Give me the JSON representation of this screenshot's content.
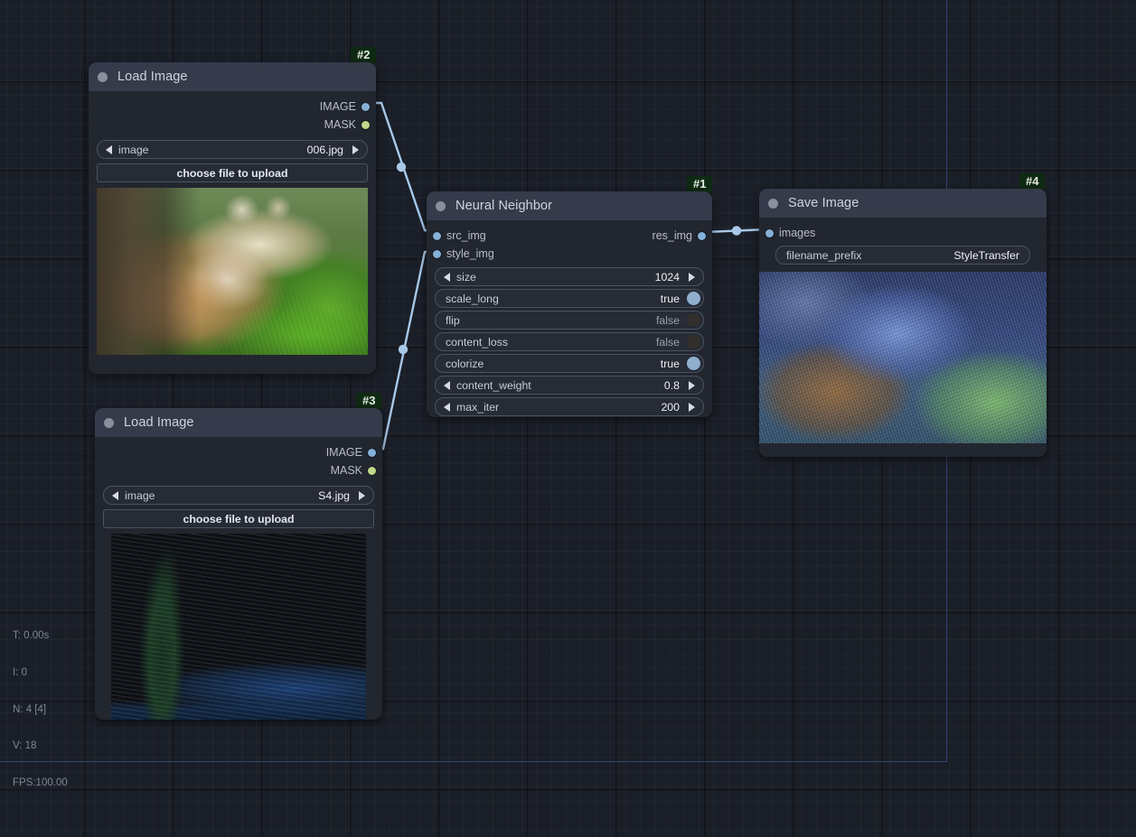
{
  "app": {
    "kind": "node-graph-editor",
    "background_color": "#1a1e27",
    "node_body_color": "#22262f",
    "node_header_color": "#353b4a",
    "link_color": "#a8c8e8",
    "badge_color": "#0f2a12"
  },
  "nodes": [
    {
      "id": "neural-neighbor",
      "badge": "#1",
      "title": "Neural Neighbor",
      "inputs": [
        {
          "name": "src_img",
          "type": "IMAGE"
        },
        {
          "name": "style_img",
          "type": "IMAGE"
        }
      ],
      "outputs": [
        {
          "name": "res_img",
          "type": "IMAGE"
        }
      ],
      "widgets": [
        {
          "name": "size",
          "value": "1024",
          "kind": "number"
        },
        {
          "name": "scale_long",
          "value": "true",
          "kind": "toggle",
          "on": true
        },
        {
          "name": "flip",
          "value": "false",
          "kind": "toggle",
          "on": false
        },
        {
          "name": "content_loss",
          "value": "false",
          "kind": "toggle",
          "on": false
        },
        {
          "name": "colorize",
          "value": "true",
          "kind": "toggle",
          "on": true
        },
        {
          "name": "content_weight",
          "value": "0.8",
          "kind": "number"
        },
        {
          "name": "max_iter",
          "value": "200",
          "kind": "number"
        }
      ]
    },
    {
      "id": "load-image-src",
      "badge": "#2",
      "title": "Load Image",
      "outputs": [
        {
          "name": "IMAGE",
          "type": "IMAGE"
        },
        {
          "name": "MASK",
          "type": "MASK"
        }
      ],
      "widgets": [
        {
          "name": "image",
          "value": "006.jpg",
          "kind": "combo"
        }
      ],
      "button": "choose file to upload",
      "preview_alt": "lynx in grass photo"
    },
    {
      "id": "load-image-style",
      "badge": "#3",
      "title": "Load Image",
      "outputs": [
        {
          "name": "IMAGE",
          "type": "IMAGE"
        },
        {
          "name": "MASK",
          "type": "MASK"
        }
      ],
      "widgets": [
        {
          "name": "image",
          "value": "S4.jpg",
          "kind": "combo"
        }
      ],
      "button": "choose file to upload",
      "preview_alt": "The Starry Night painting"
    },
    {
      "id": "save-image",
      "badge": "#4",
      "title": "Save Image",
      "inputs": [
        {
          "name": "images",
          "type": "IMAGE"
        }
      ],
      "widgets": [
        {
          "name": "filename_prefix",
          "value": "StyleTransfer",
          "kind": "text"
        }
      ],
      "preview_alt": "stylized lynx result"
    }
  ],
  "links": [
    {
      "from": "load-image-src.IMAGE",
      "to": "neural-neighbor.src_img"
    },
    {
      "from": "load-image-style.IMAGE",
      "to": "neural-neighbor.style_img"
    },
    {
      "from": "neural-neighbor.res_img",
      "to": "save-image.images"
    }
  ],
  "status": {
    "time": "T: 0.00s",
    "iterations": "I: 0",
    "nodes": "N: 4 [4]",
    "vertices": "V: 18",
    "fps": "FPS:100.00"
  }
}
